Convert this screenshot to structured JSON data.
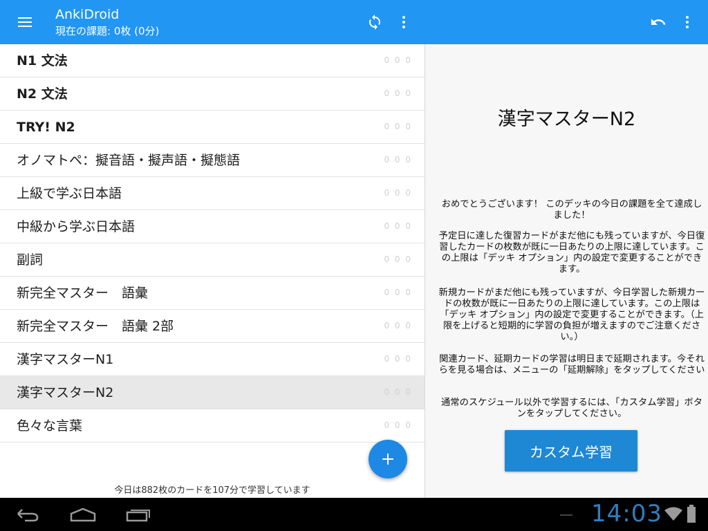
{
  "app": {
    "title": "AnkiDroid",
    "subtitle": "現在の課題: 0枚 (0分)",
    "accent": "#2196f3"
  },
  "toolbar": {
    "menu_icon": "hamburger-menu-icon",
    "sync_icon": "sync-icon",
    "overflow_icon": "more-vert-icon",
    "undo_icon": "undo-icon"
  },
  "decks": [
    {
      "name": "N1 文法",
      "counts": "0 0 0",
      "bold_prefix": true,
      "selected": false
    },
    {
      "name": "N2 文法",
      "counts": "0 0 0",
      "bold_prefix": true,
      "selected": false
    },
    {
      "name": "TRY! N2",
      "counts": "0 0 0",
      "bold_prefix": true,
      "selected": false
    },
    {
      "name": "オノマトペ：擬音語・擬声語・擬態語",
      "counts": "0 0 0",
      "bold_prefix": false,
      "selected": false
    },
    {
      "name": "上級で学ぶ日本語",
      "counts": "0 0 0",
      "bold_prefix": false,
      "selected": false
    },
    {
      "name": "中級から学ぶ日本語",
      "counts": "0 0 0",
      "bold_prefix": false,
      "selected": false
    },
    {
      "name": "副詞",
      "counts": "0 0 0",
      "bold_prefix": false,
      "selected": false
    },
    {
      "name": "新完全マスター　語彙",
      "counts": "0 0 0",
      "bold_prefix": false,
      "selected": false
    },
    {
      "name": "新完全マスター　語彙 2部",
      "counts": "0 0 0",
      "bold_prefix": false,
      "selected": false
    },
    {
      "name": "漢字マスターN1",
      "counts": "0 0 0",
      "bold_prefix": false,
      "selected": false
    },
    {
      "name": "漢字マスターN2",
      "counts": "0 0 0",
      "bold_prefix": false,
      "selected": true
    },
    {
      "name": "色々な言葉",
      "counts": "0 0 0",
      "bold_prefix": false,
      "selected": false
    }
  ],
  "footer_note": "今日は882枚のカードを107分で学習しています",
  "detail": {
    "title": "漢字マスターN2",
    "messages": [
      "おめでとうございます！ このデッキの今日の課題を全て達成しました！",
      "予定日に達した復習カードがまだ他にも残っていますが、今日復習したカードの枚数が既に一日あたりの上限に達しています。この上限は「デッキ オプション」内の設定で変更することができます。",
      "新規カードがまだ他にも残っていますが、今日学習した新規カードの枚数が既に一日あたりの上限に達しています。この上限は「デッキ オプション」内の設定で変更することができます。（上限を上げると短期的に学習の負担が増えますのでご注意ください。）",
      "関連カード、延期カードの学習は明日まで延期されます。今それらを見る場合は、メニューの「延期解除」をタップしてください",
      "通常のスケジュール以外で学習するには、「カスタム学習」ボタンをタップしてください。"
    ],
    "custom_study_label": "カスタム学習"
  },
  "system": {
    "clock": "14:03",
    "back_icon": "back-icon",
    "home_icon": "home-icon",
    "recents_icon": "recents-icon",
    "wifi_icon": "wifi-icon",
    "battery_icon": "battery-icon"
  }
}
